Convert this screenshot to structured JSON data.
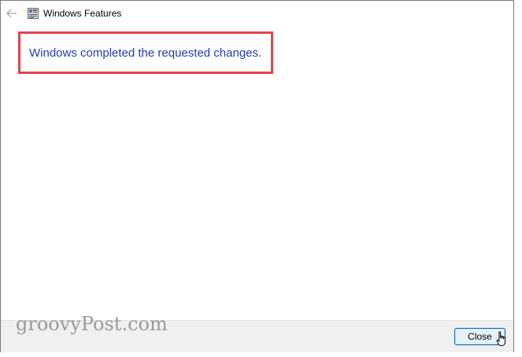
{
  "window": {
    "title": "Windows Features",
    "back_icon": "back-arrow-icon",
    "app_icon": "windows-features-icon"
  },
  "main": {
    "message": "Windows completed the requested changes.",
    "message_color": "#1f3fa8",
    "highlight_color": "#e0454a"
  },
  "footer": {
    "watermark": "groovyPost.com",
    "close_label": "Close"
  },
  "cursor_icon": "hand-pointer-icon"
}
